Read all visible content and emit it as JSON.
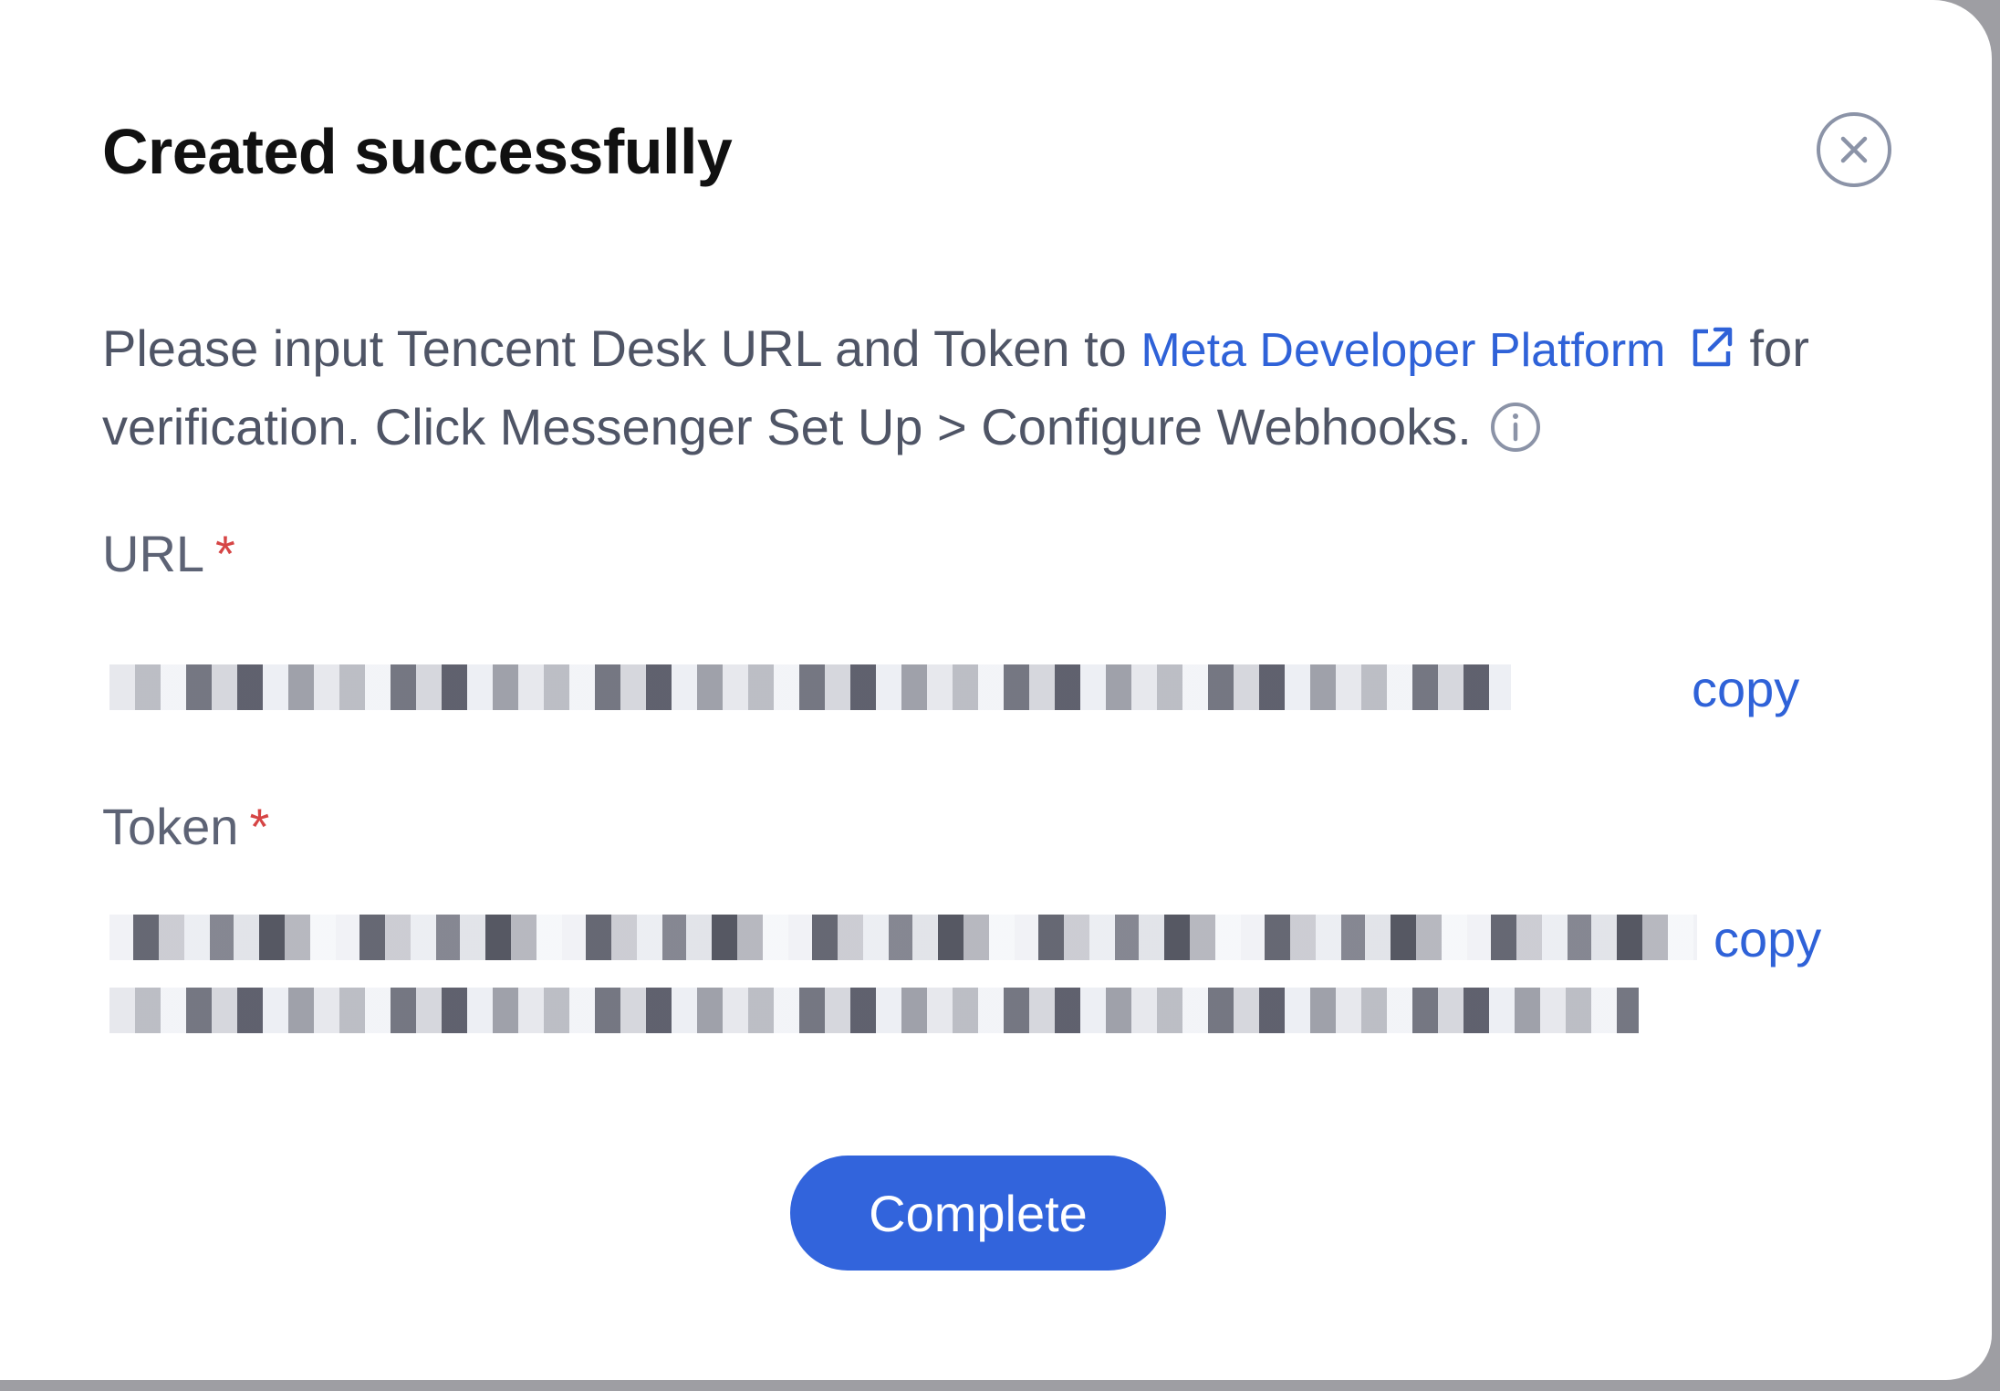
{
  "dialog": {
    "title": "Created successfully",
    "description": {
      "before_link": "Please input Tencent Desk URL and Token to ",
      "link": "Meta Developer Platform",
      "after_link": " for verification. Click Messenger Set Up > Configure Webhooks."
    },
    "url_field": {
      "label": "URL",
      "required_mark": "*",
      "copy_label": "copy"
    },
    "token_field": {
      "label": "Token",
      "required_mark": "*",
      "copy_label": "copy"
    },
    "primary_button": "Complete"
  },
  "icons": {
    "close": "close-circle-icon",
    "external_link": "external-link-icon",
    "info": "info-circle-icon"
  },
  "colors": {
    "accent": "#3264dc",
    "link": "#2f62d8",
    "required": "#d64545"
  }
}
